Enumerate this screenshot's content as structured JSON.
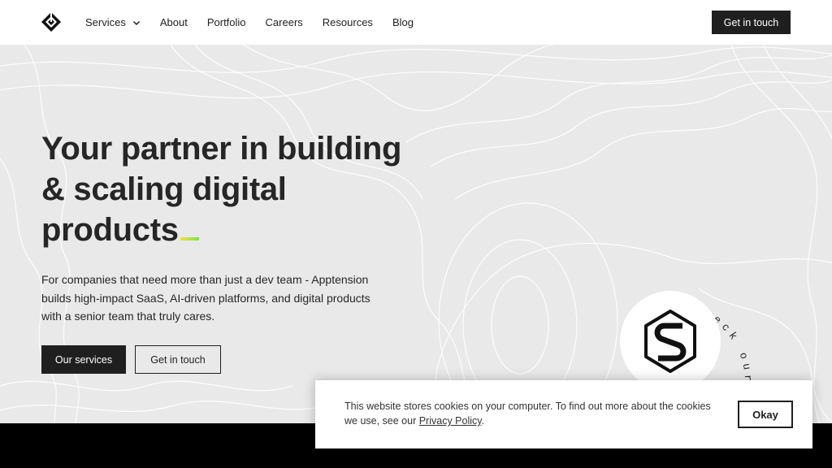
{
  "nav": {
    "logo_icon": "apptension-logo-icon",
    "items": [
      {
        "label": "Services",
        "has_dropdown": true
      },
      {
        "label": "About"
      },
      {
        "label": "Portfolio"
      },
      {
        "label": "Careers"
      },
      {
        "label": "Resources"
      },
      {
        "label": "Blog"
      }
    ],
    "cta_label": "Get in touch"
  },
  "hero": {
    "headline_lines": [
      "Your partner in building",
      "& scaling digital",
      "products"
    ],
    "description_lines": [
      "For companies that need more than just a dev team - Apptension",
      "builds high-impact SaaS, AI-driven platforms, and digital products",
      "with a senior team that truly cares."
    ],
    "primary_button": "Our services",
    "secondary_button": "Get in touch",
    "background_color": "#e9e9e9",
    "accent_gradient": [
      "#f3e13a",
      "#7ee04e"
    ]
  },
  "badge": {
    "circular_text": "Check our open-source boilerplate .",
    "icon": "saas-boilerplate-logo-icon"
  },
  "cookie_banner": {
    "text_line1": "This website stores cookies on your computer. To find out more about the cookies",
    "text_line2_prefix": "we use, see our ",
    "link_label": "Privacy Policy",
    "text_line2_suffix": ".",
    "button_label": "Okay"
  }
}
